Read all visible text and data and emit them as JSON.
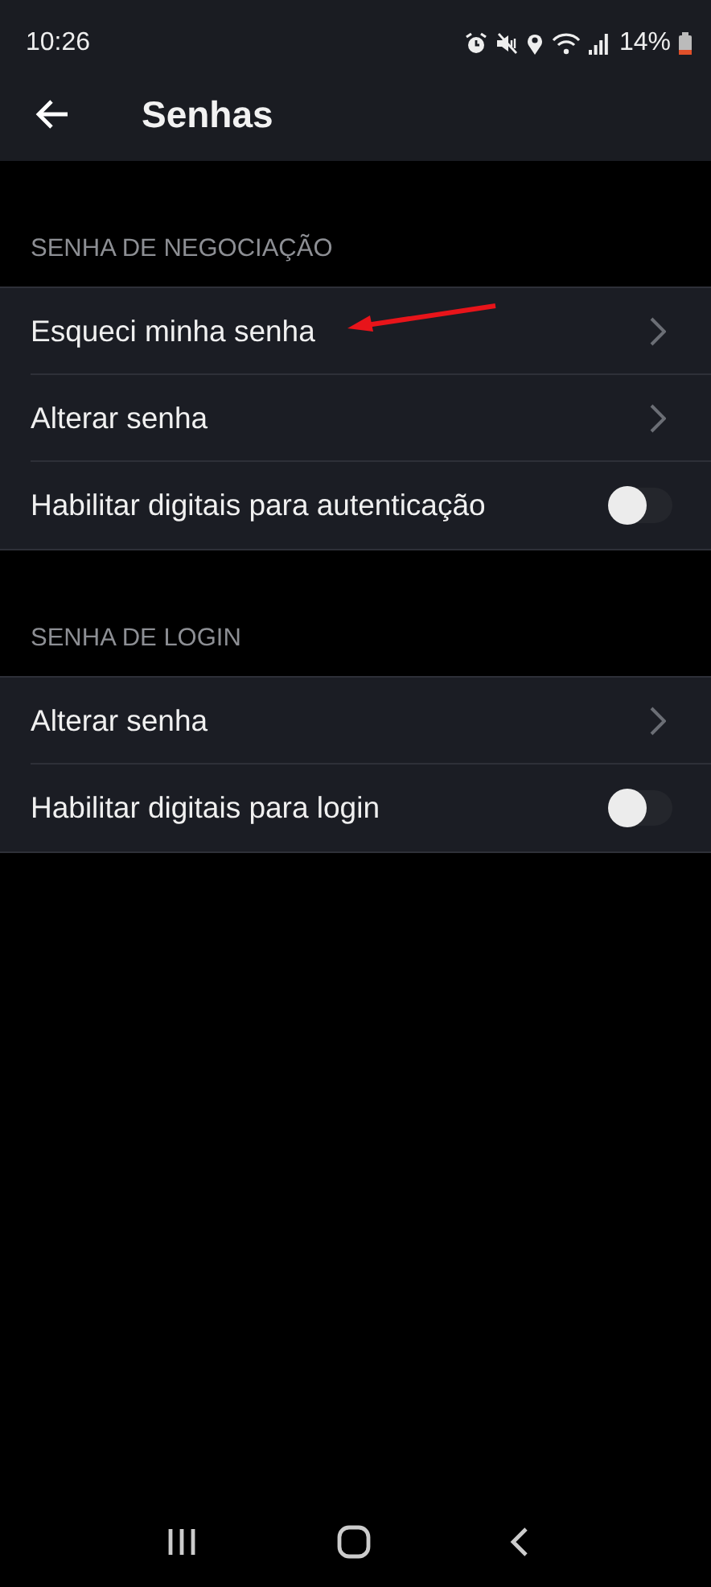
{
  "status_bar": {
    "time": "10:26",
    "battery": "14%"
  },
  "header": {
    "title": "Senhas"
  },
  "sections": [
    {
      "title": "SENHA DE NEGOCIAÇÃO",
      "items": [
        {
          "kind": "link",
          "label": "Esqueci minha senha",
          "annotated": true
        },
        {
          "kind": "link",
          "label": "Alterar senha",
          "annotated": false
        },
        {
          "kind": "toggle",
          "label": "Habilitar digitais para autenticação",
          "on": false,
          "annotated": false
        }
      ]
    },
    {
      "title": "SENHA DE LOGIN",
      "items": [
        {
          "kind": "link",
          "label": "Alterar senha",
          "annotated": false
        },
        {
          "kind": "toggle",
          "label": "Habilitar digitais para login",
          "on": false,
          "annotated": false
        }
      ]
    }
  ]
}
